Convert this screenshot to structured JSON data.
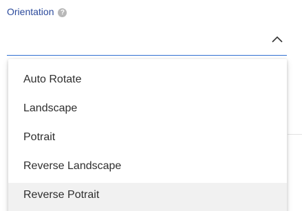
{
  "field": {
    "label": "Orientation",
    "help_icon": "question-icon",
    "selected_value": "",
    "toggle_icon": "chevron-up-icon",
    "accent_color": "#2e6fd0"
  },
  "dropdown": {
    "options": [
      {
        "label": "Auto Rotate"
      },
      {
        "label": "Landscape"
      },
      {
        "label": "Potrait"
      },
      {
        "label": "Reverse Landscape"
      },
      {
        "label": "Reverse Potrait"
      }
    ]
  }
}
